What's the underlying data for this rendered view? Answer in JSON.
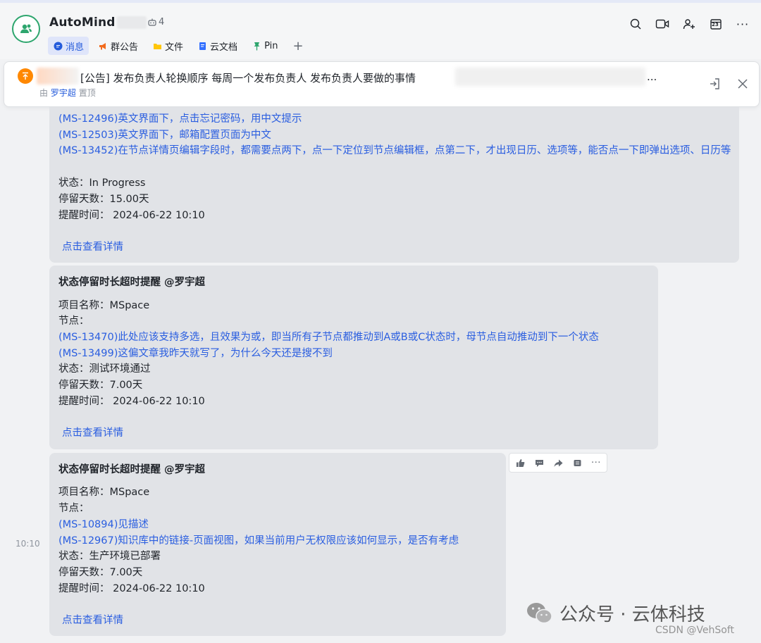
{
  "header": {
    "title": "AutoMind",
    "bot_count": "4",
    "tabs": [
      {
        "label": "消息",
        "icon": "chat-bubble-icon"
      },
      {
        "label": "群公告",
        "icon": "megaphone-icon"
      },
      {
        "label": "文件",
        "icon": "folder-icon"
      },
      {
        "label": "云文档",
        "icon": "doc-icon"
      },
      {
        "label": "Pin",
        "icon": "pin-icon"
      }
    ],
    "add_tab": "+",
    "tools": [
      "search-icon",
      "video-icon",
      "add-member-icon",
      "calendar-icon",
      "more-icon"
    ],
    "calendar_day": "23"
  },
  "pinned": {
    "text": "[公告] 发布负责人轮换顺序 每周一个发布负责人 发布负责人要做的事情",
    "tail": "...",
    "by_prefix": "由",
    "by_user": "罗宇超",
    "by_suffix": "置顶"
  },
  "messages": [
    {
      "lines": [
        {
          "text": "(MS-12496)英文界面下，点击忘记密码，用中文提示",
          "link": true
        },
        {
          "text": "(MS-12503)英文界面下，邮箱配置页面为中文",
          "link": true
        },
        {
          "text": "(MS-13452)在节点详情页编辑字段时，都需要点两下，点一下定位到节点编辑框，点第二下，才出现日历、选项等，能否点一下即弹出选项、日历等",
          "link": true
        },
        {
          "text": "状态：In Progress"
        },
        {
          "text": "停留天数：15.00天"
        },
        {
          "text": "提醒时间： 2024-06-22 10:10"
        }
      ],
      "detail": "点击查看详情"
    },
    {
      "title": "状态停留时长超时提醒 @罗宇超",
      "lines": [
        {
          "text": "项目名称：MSpace"
        },
        {
          "text": "节点："
        },
        {
          "text": "(MS-13470)此处应该支持多选，且效果为或，即当所有子节点都推动到A或B或C状态时，母节点自动推动到下一个状态",
          "link": true
        },
        {
          "text": "(MS-13499)这偏文章我昨天就写了，为什么今天还是搜不到",
          "link": true
        },
        {
          "text": "状态：测试环境通过"
        },
        {
          "text": "停留天数：7.00天"
        },
        {
          "text": "提醒时间： 2024-06-22 10:10"
        }
      ],
      "detail": "点击查看详情"
    },
    {
      "title": "状态停留时长超时提醒 @罗宇超",
      "lines": [
        {
          "text": "项目名称：MSpace"
        },
        {
          "text": "节点："
        },
        {
          "text": "(MS-10894)见描述",
          "link": true
        },
        {
          "text": "(MS-12967)知识库中的链接-页面视图，如果当前用户无权限应该如何显示，是否有考虑",
          "link": true
        },
        {
          "text": "状态：生产环境已部署"
        },
        {
          "text": "停留天数：7.00天"
        },
        {
          "text": "提醒时间： 2024-06-22 10:10"
        }
      ],
      "detail": "点击查看详情",
      "timestamp": "10:10"
    }
  ],
  "reactions": [
    "thumbs-up-icon",
    "comment-icon",
    "forward-icon",
    "quote-icon",
    "more-icon"
  ],
  "watermark": {
    "text": "公众号 · 云体科技",
    "csdn": "CSDN @VehSoft"
  },
  "colors": {
    "link": "#2a5ee0",
    "bubble": "#e1e3e7",
    "accent": "#245bdb",
    "pin": "#ff8800"
  }
}
